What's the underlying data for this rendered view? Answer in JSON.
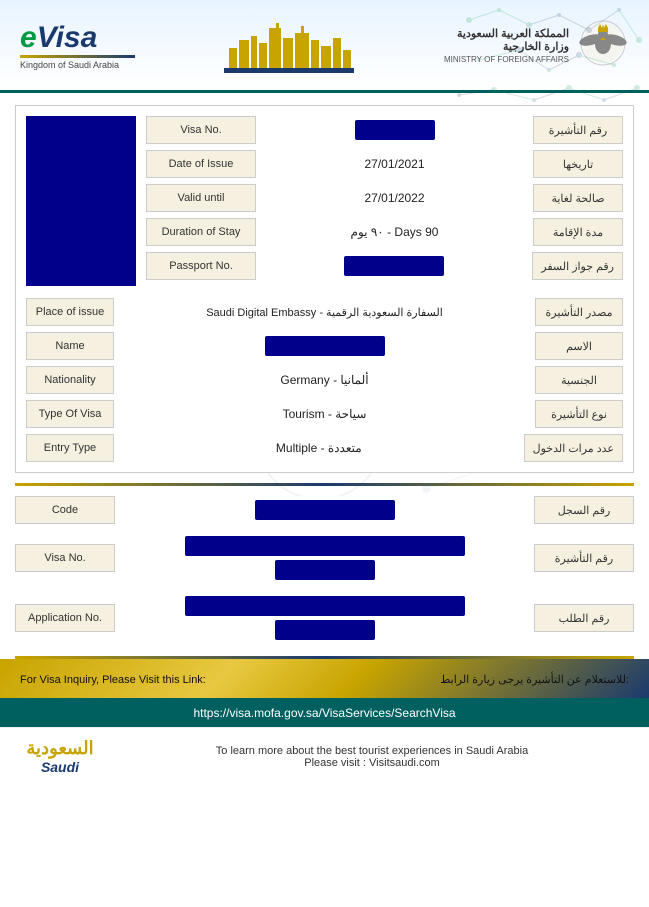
{
  "header": {
    "evisa_e": "e",
    "evisa_visa": "Visa",
    "evisa_subtitle": "Kingdom of Saudi Arabia",
    "mofa_line1": "المملكة العربية السعودية",
    "mofa_line2": "وزارة الخارجية",
    "mofa_label": "MINISTRY OF FOREIGN AFFAIRS"
  },
  "fields": {
    "visa_no_label": "Visa No.",
    "visa_no_label_ar": "رقم التأشيرة",
    "date_of_issue_label": "Date of Issue",
    "date_of_issue_label_ar": "تاريخها",
    "date_of_issue_value": "27/01/2021",
    "valid_until_label": "Valid until",
    "valid_until_label_ar": "صالحة لغاية",
    "valid_until_value": "27/01/2022",
    "duration_label": "Duration of Stay",
    "duration_label_ar": "مدة الإقامة",
    "duration_value": "90 Days - ٩٠ يوم",
    "passport_label": "Passport No.",
    "passport_label_ar": "رقم جواز السفر",
    "place_label": "Place of issue",
    "place_label_ar": "مصدر التأشيرة",
    "place_value": "السفارة السعودية الرقمية - Saudi Digital Embassy",
    "name_label": "Name",
    "name_label_ar": "الاسم",
    "nationality_label": "Nationality",
    "nationality_label_ar": "الجنسية",
    "nationality_value": "ألمانيا - Germany",
    "type_label": "Type Of Visa",
    "type_label_ar": "نوع التأشيرة",
    "type_value": "سياحة - Tourism",
    "entry_label": "Entry Type",
    "entry_label_ar": "عدد مرات الدخول",
    "entry_value": "متعددة - Multiple",
    "code_label": "Code",
    "code_label_ar": "رقم السجل",
    "visa_no2_label": "Visa No.",
    "visa_no2_label_ar": "رقم التأشيرة",
    "app_label": "Application No.",
    "app_label_ar": "رقم الطلب"
  },
  "footer": {
    "inquiry_ar": "للاستعلام عن التأشيرة يرجى زيارة الرابط:",
    "inquiry_en": "For Visa Inquiry, Please Visit this Link:",
    "link": "https://visa.mofa.gov.sa/VisaServices/SearchVisa",
    "visit_text_line1": "To learn more about the best tourist experiences in Saudi Arabia",
    "visit_text_line2": "Please visit : Visitsaudi.com",
    "saudi_logo_ar": "السعودية",
    "saudi_logo_en": "Saudi"
  }
}
